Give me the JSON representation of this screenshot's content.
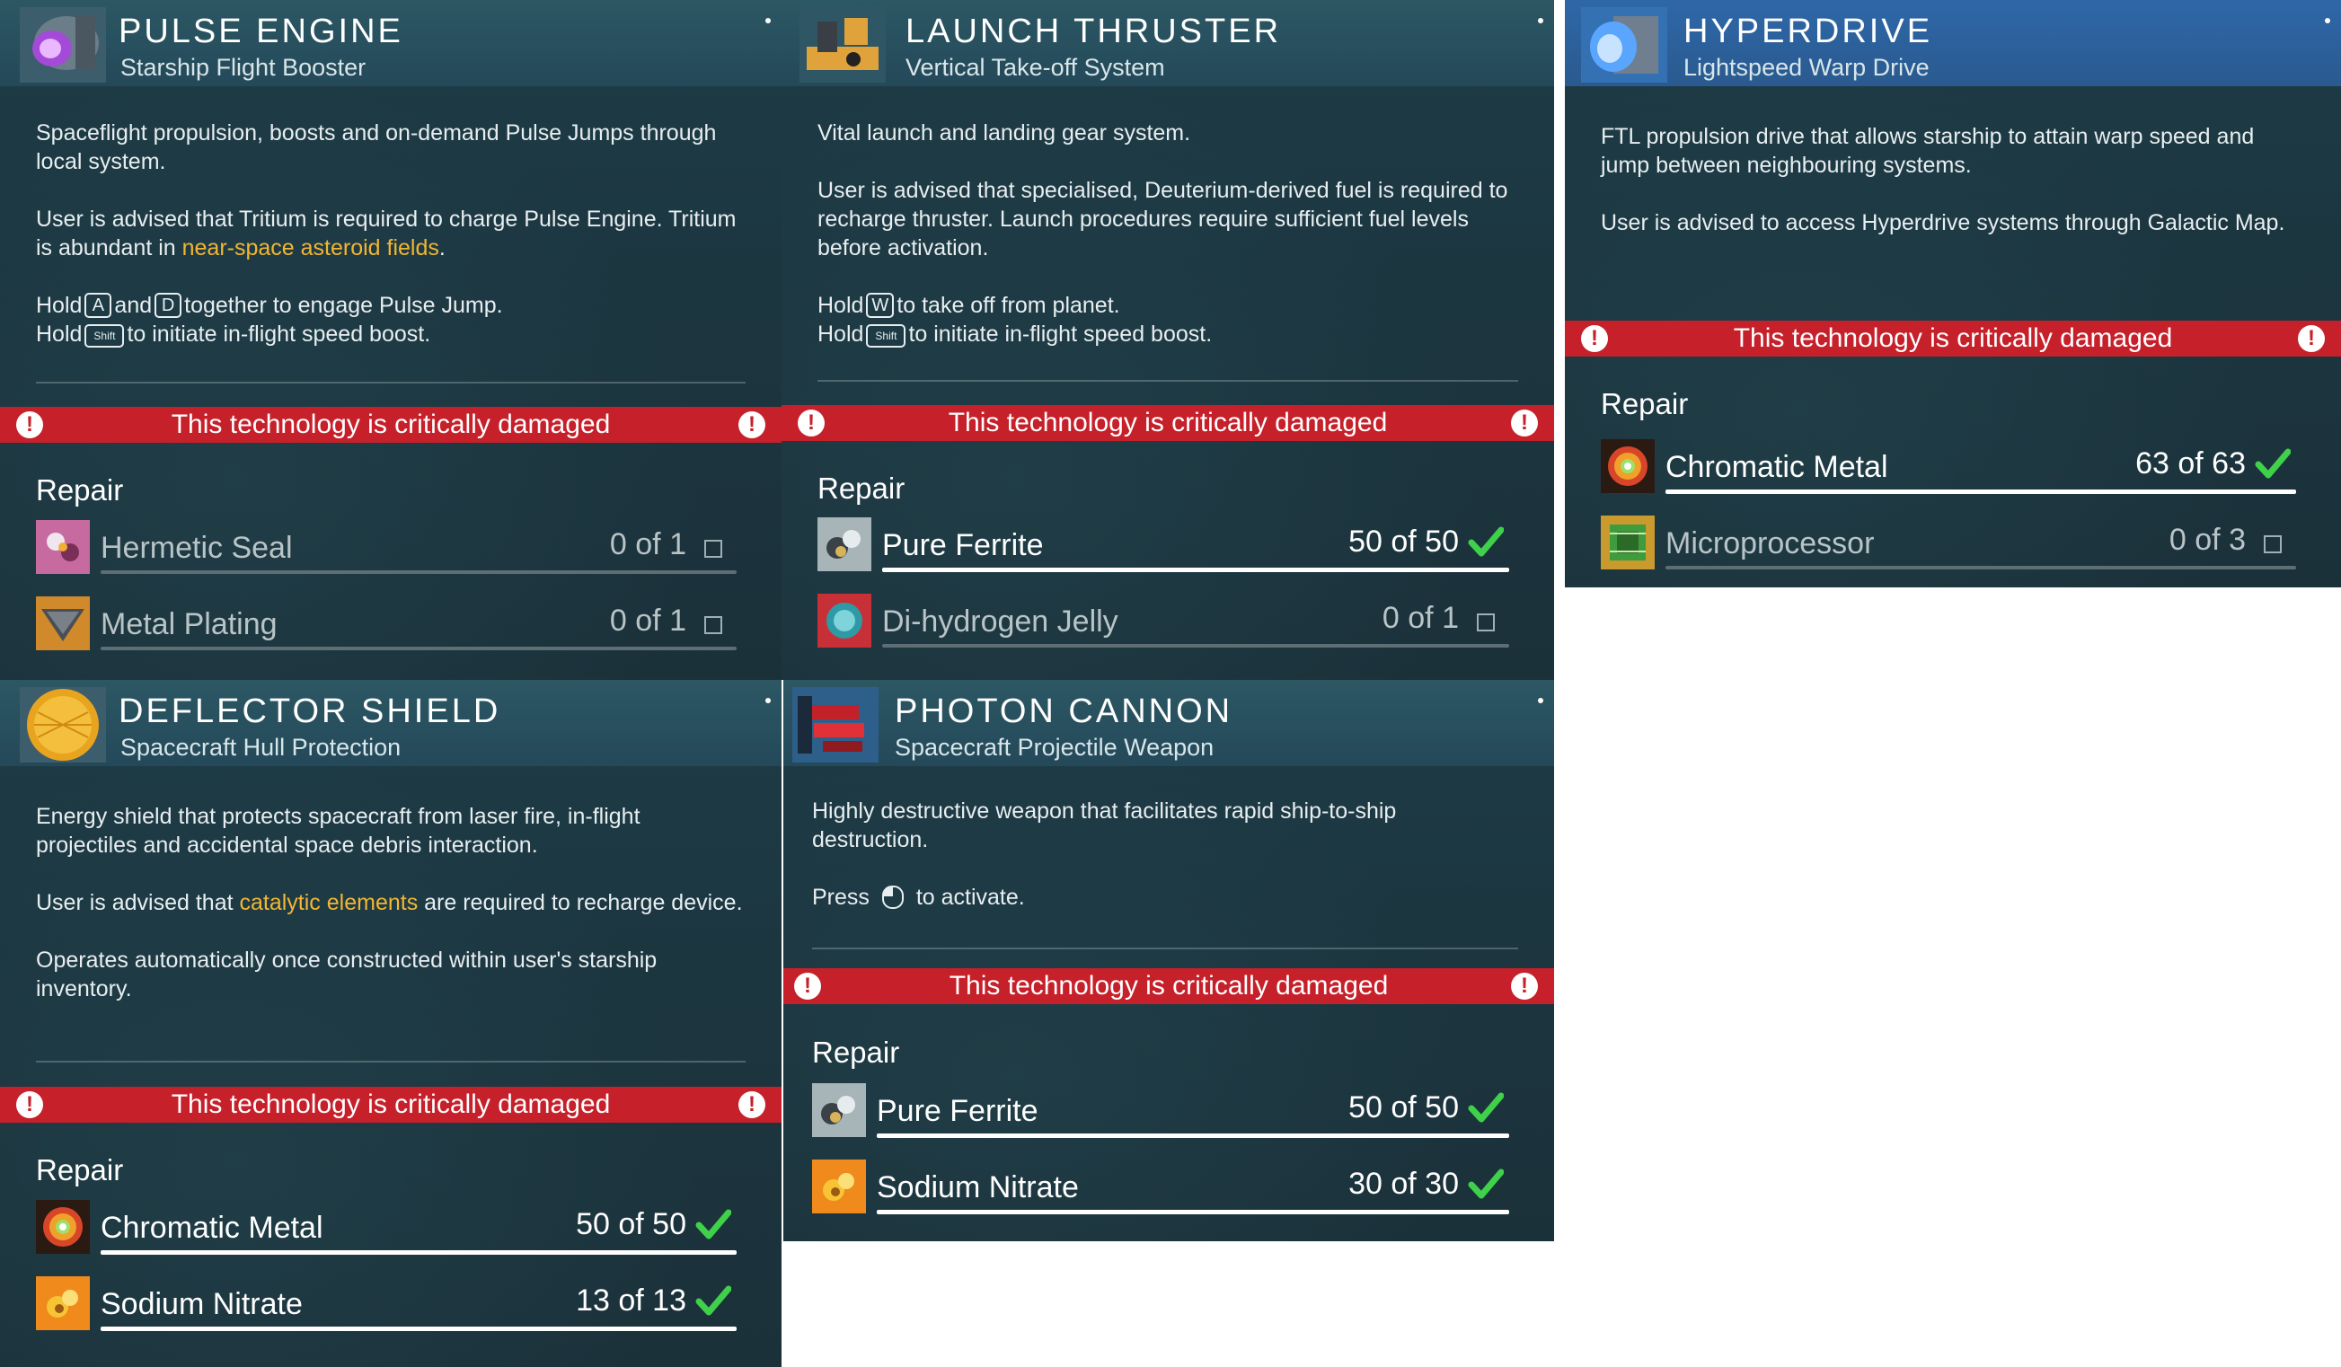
{
  "warning_text": "This technology is critically damaged",
  "repair_label": "Repair",
  "panels": {
    "pulse": {
      "title": "PULSE ENGINE",
      "subtitle": "Starship Flight Booster",
      "desc1": "Spaceflight propulsion, boosts and on-demand Pulse Jumps through local system.",
      "desc2_a": "User is advised that Tritium is required to charge Pulse Engine. Tritium is abundant in ",
      "desc2_hl": "near-space asteroid fields",
      "desc2_b": ".",
      "hold1_a": "Hold",
      "key_a": "A",
      "hold1_and": "and",
      "key_d": "D",
      "hold1_b": "together to engage Pulse Jump.",
      "hold2_a": "Hold",
      "key_shift": "Shift",
      "hold2_b": "to initiate in-flight speed boost.",
      "items": [
        {
          "name": "Hermetic Seal",
          "count": "0 of 1",
          "complete": false
        },
        {
          "name": "Metal Plating",
          "count": "0 of 1",
          "complete": false
        }
      ]
    },
    "launch": {
      "title": "LAUNCH THRUSTER",
      "subtitle": "Vertical Take-off System",
      "desc1": "Vital launch and landing gear system.",
      "desc2": "User is advised that specialised, Deuterium-derived fuel is required to recharge thruster. Launch procedures require sufficient fuel levels before activation.",
      "hold1_a": "Hold",
      "key_w": "W",
      "hold1_b": "to take off from planet.",
      "hold2_a": "Hold",
      "key_shift": "Shift",
      "hold2_b": "to initiate in-flight speed boost.",
      "items": [
        {
          "name": "Pure Ferrite",
          "count": "50 of 50",
          "complete": true
        },
        {
          "name": "Di-hydrogen Jelly",
          "count": "0 of 1",
          "complete": false
        }
      ]
    },
    "hyper": {
      "title": "HYPERDRIVE",
      "subtitle": "Lightspeed Warp Drive",
      "desc1": "FTL propulsion drive that allows starship to attain warp speed and jump between neighbouring systems.",
      "desc2": "User is advised to access Hyperdrive systems through Galactic Map.",
      "items": [
        {
          "name": "Chromatic Metal",
          "count": "63 of 63",
          "complete": true
        },
        {
          "name": "Microprocessor",
          "count": "0 of 3",
          "complete": false
        }
      ]
    },
    "deflector": {
      "title": "DEFLECTOR SHIELD",
      "subtitle": "Spacecraft Hull Protection",
      "desc1": "Energy shield that protects spacecraft from laser fire, in-flight projectiles and accidental space debris interaction.",
      "desc2_a": "User is advised that ",
      "desc2_hl": "catalytic elements",
      "desc2_b": " are required to recharge device.",
      "desc3": "Operates automatically once constructed within user's starship inventory.",
      "items": [
        {
          "name": "Chromatic Metal",
          "count": "50 of 50",
          "complete": true
        },
        {
          "name": "Sodium Nitrate",
          "count": "13 of 13",
          "complete": true
        }
      ]
    },
    "photon": {
      "title": "PHOTON CANNON",
      "subtitle": "Spacecraft Projectile Weapon",
      "desc1": "Highly destructive weapon that facilitates rapid ship-to-ship destruction.",
      "press_a": "Press",
      "press_b": "to activate.",
      "items": [
        {
          "name": "Pure Ferrite",
          "count": "50 of 50",
          "complete": true
        },
        {
          "name": "Sodium Nitrate",
          "count": "30 of 30",
          "complete": true
        }
      ]
    }
  }
}
